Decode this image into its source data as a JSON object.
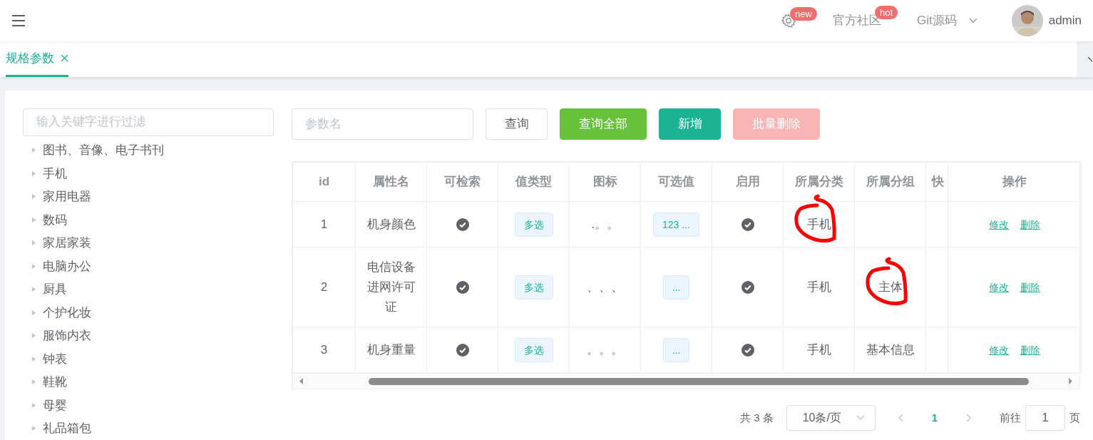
{
  "header": {
    "links": [
      {
        "kind": "icon",
        "badge": "new"
      },
      {
        "kind": "text",
        "label": "官方社区",
        "badge": "hot"
      },
      {
        "kind": "dropdown",
        "label": "Git源码"
      }
    ],
    "user": {
      "name": "admin"
    }
  },
  "tabs": [
    {
      "label": "规格参数",
      "selected": true,
      "closable": true
    }
  ],
  "tree": {
    "filter_placeholder": "输入关键字进行过滤",
    "items": [
      {
        "label": "图书、音像、电子书刊",
        "expanded": false
      },
      {
        "label": "手机",
        "expanded": false
      },
      {
        "label": "家用电器",
        "expanded": false
      },
      {
        "label": "数码",
        "expanded": false
      },
      {
        "label": "家居家装",
        "expanded": false
      },
      {
        "label": "电脑办公",
        "expanded": false
      },
      {
        "label": "厨具",
        "expanded": false
      },
      {
        "label": "个护化妆",
        "expanded": false
      },
      {
        "label": "服饰内衣",
        "expanded": false
      },
      {
        "label": "钟表",
        "expanded": false
      },
      {
        "label": "鞋靴",
        "expanded": false
      },
      {
        "label": "母婴",
        "expanded": false
      },
      {
        "label": "礼品箱包",
        "expanded": false
      }
    ]
  },
  "toolbar": {
    "search_placeholder": "参数名",
    "buttons": [
      {
        "label": "查询",
        "kind": "default",
        "disabled": false
      },
      {
        "label": "查询全部",
        "kind": "success",
        "disabled": false
      },
      {
        "label": "新增",
        "kind": "primary",
        "disabled": false
      },
      {
        "label": "批量删除",
        "kind": "danger",
        "disabled": true
      }
    ]
  },
  "table": {
    "columns": [
      "id",
      "属性名",
      "可检索",
      "值类型",
      "图标",
      "可选值",
      "启用",
      "所属分类",
      "所属分组",
      "快",
      "操作"
    ],
    "rows": [
      {
        "id": "1",
        "name": "机身颜色",
        "searchable": true,
        "value_type": "多选",
        "icon": ".。。",
        "options": "123 ...",
        "enabled": true,
        "category": "手机",
        "category_circled": true,
        "group_circled": false,
        "actions": [
          "修改",
          "删除"
        ]
      },
      {
        "id": "2",
        "name": "电信设备进网许可证",
        "searchable": true,
        "value_type": "多选",
        "icon": "、、、",
        "options": "...",
        "enabled": true,
        "category": "手机",
        "category_circled": false,
        "group": "主体",
        "group_circled": true,
        "actions": [
          "修改",
          "删除"
        ]
      },
      {
        "id": "3",
        "name": "机身重量",
        "searchable": true,
        "value_type": "多选",
        "icon": "。。。",
        "options": "...",
        "enabled": true,
        "category": "手机",
        "category_circled": false,
        "group": "基本信息",
        "group_circled": false,
        "actions": [
          "修改",
          "删除"
        ]
      }
    ]
  },
  "pagination": {
    "total": "共 3 条",
    "page_size": "10条/页",
    "pages": [
      {
        "label": "1",
        "selected": true
      }
    ],
    "goto_label": "前往",
    "goto_value": "1",
    "goto_suffix": "页"
  }
}
